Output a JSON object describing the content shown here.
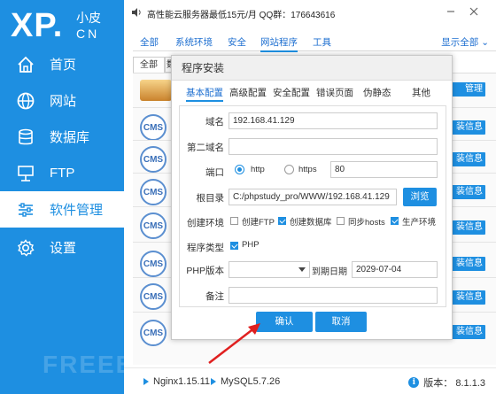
{
  "app": {
    "logo_main": "XP.",
    "logo_top": "小皮",
    "logo_bottom": "CN"
  },
  "sidebar": {
    "items": [
      {
        "label": "首页",
        "icon": "home-icon"
      },
      {
        "label": "网站",
        "icon": "globe-icon"
      },
      {
        "label": "数据库",
        "icon": "database-icon"
      },
      {
        "label": "FTP",
        "icon": "ftp-icon"
      },
      {
        "label": "软件管理",
        "icon": "sliders-icon",
        "active": true
      },
      {
        "label": "设置",
        "icon": "gear-icon"
      }
    ]
  },
  "topbar": {
    "promo": "高性能云服务器最低15元/月   QQ群：176643616"
  },
  "tabs": {
    "items": [
      "全部",
      "系统环境",
      "安全",
      "网站程序",
      "工具"
    ],
    "active": "网站程序",
    "show_all": "显示全部"
  },
  "background": {
    "subtab": "全部",
    "cms_label": "CMS",
    "side_buttons": [
      "管理",
      "装信息",
      "装信息",
      "装信息",
      "装信息",
      "装信息",
      "装信息",
      "装信息"
    ]
  },
  "dialog": {
    "title": "程序安装",
    "tabs": [
      "基本配置",
      "高级配置",
      "安全配置",
      "错误页面",
      "伪静态",
      "其他"
    ],
    "active_tab": "基本配置",
    "fields": {
      "domain_label": "域名",
      "domain_value": "192.168.41.129",
      "second_domain_label": "第二域名",
      "second_domain_value": "",
      "port_label": "端口",
      "http_label": "http",
      "https_label": "https",
      "port_value": "80",
      "root_label": "根目录",
      "root_value": "C:/phpstudy_pro/WWW/192.168.41.129",
      "browse_label": "浏览",
      "env_label": "创建环境",
      "env_options": [
        {
          "label": "创建FTP",
          "checked": false
        },
        {
          "label": "创建数据库",
          "checked": true
        },
        {
          "label": "同步hosts",
          "checked": false
        },
        {
          "label": "生产环境",
          "checked": true
        }
      ],
      "program_type_label": "程序类型",
      "program_type_option": "PHP",
      "php_version_label": "PHP版本",
      "php_version_value": "",
      "expire_label": "到期日期",
      "expire_value": "2029-07-04",
      "note_label": "备注",
      "note_value": ""
    },
    "confirm_label": "确认",
    "cancel_label": "取消"
  },
  "statusbar": {
    "nginx": "Nginx1.15.11",
    "mysql": "MySQL5.7.26",
    "version": "版本：  8.1.1.3"
  },
  "colors": {
    "accent": "#1e8fe1",
    "arrow": "#e02020"
  },
  "watermark": "FREEBUF"
}
